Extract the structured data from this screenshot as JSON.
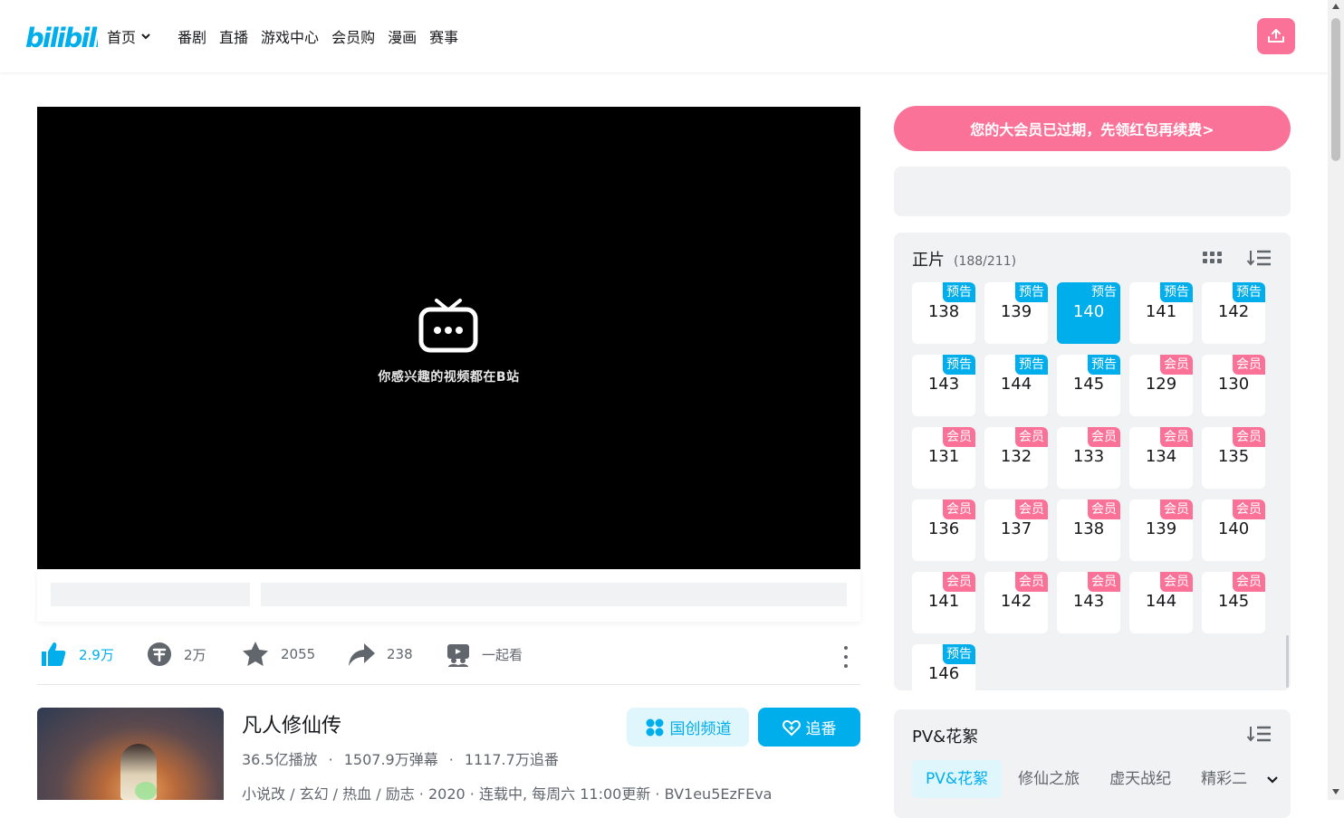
{
  "header": {
    "logo_text": "bilibili",
    "nav": {
      "home": "首页",
      "items": [
        "番剧",
        "直播",
        "游戏中心",
        "会员购",
        "漫画",
        "赛事"
      ]
    },
    "upload_icon": "upload-icon"
  },
  "player": {
    "slogan": "你感兴趣的视频都在B站"
  },
  "toolbar": {
    "like": "2.9万",
    "coin": "2万",
    "favorite": "2055",
    "share": "238",
    "together": "一起看"
  },
  "media": {
    "title": "凡人修仙传",
    "plays": "36.5亿播放",
    "danmaku": "1507.9万弹幕",
    "follows": "1117.7万追番",
    "tags": "小说改 / 玄幻 / 热血 / 励志",
    "year": "2020",
    "status": "连载中, 每周六 11:00更新",
    "bvid": "BV1eu5EzFEva",
    "channel_button": "国创频道",
    "follow_button": "追番"
  },
  "sidebar": {
    "vip_banner": "您的大会员已过期，先领红包再续费>",
    "episodes": {
      "title": "正片",
      "count": "(188/211)",
      "active": "140",
      "badge_labels": {
        "preview": "预告",
        "member": "会员"
      },
      "list": [
        {
          "num": "138",
          "badge": "预告",
          "type": "preview"
        },
        {
          "num": "139",
          "badge": "预告",
          "type": "preview"
        },
        {
          "num": "140",
          "badge": "预告",
          "type": "preview"
        },
        {
          "num": "141",
          "badge": "预告",
          "type": "preview"
        },
        {
          "num": "142",
          "badge": "预告",
          "type": "preview"
        },
        {
          "num": "143",
          "badge": "预告",
          "type": "preview"
        },
        {
          "num": "144",
          "badge": "预告",
          "type": "preview"
        },
        {
          "num": "145",
          "badge": "预告",
          "type": "preview"
        },
        {
          "num": "129",
          "badge": "会员",
          "type": "member"
        },
        {
          "num": "130",
          "badge": "会员",
          "type": "member"
        },
        {
          "num": "131",
          "badge": "会员",
          "type": "member"
        },
        {
          "num": "132",
          "badge": "会员",
          "type": "member"
        },
        {
          "num": "133",
          "badge": "会员",
          "type": "member"
        },
        {
          "num": "134",
          "badge": "会员",
          "type": "member"
        },
        {
          "num": "135",
          "badge": "会员",
          "type": "member"
        },
        {
          "num": "136",
          "badge": "会员",
          "type": "member"
        },
        {
          "num": "137",
          "badge": "会员",
          "type": "member"
        },
        {
          "num": "138",
          "badge": "会员",
          "type": "member"
        },
        {
          "num": "139",
          "badge": "会员",
          "type": "member"
        },
        {
          "num": "140",
          "badge": "会员",
          "type": "member"
        },
        {
          "num": "141",
          "badge": "会员",
          "type": "member"
        },
        {
          "num": "142",
          "badge": "会员",
          "type": "member"
        },
        {
          "num": "143",
          "badge": "会员",
          "type": "member"
        },
        {
          "num": "144",
          "badge": "会员",
          "type": "member"
        },
        {
          "num": "145",
          "badge": "会员",
          "type": "member"
        },
        {
          "num": "146",
          "badge": "预告",
          "type": "preview"
        }
      ]
    },
    "pv": {
      "title": "PV&花絮",
      "tabs": [
        "PV&花絮",
        "修仙之旅",
        "虚天战纪",
        "精彩二"
      ]
    }
  },
  "colors": {
    "brand_blue": "#00aeec",
    "brand_pink": "#fb7299",
    "panel_bg": "#f1f2f3"
  }
}
